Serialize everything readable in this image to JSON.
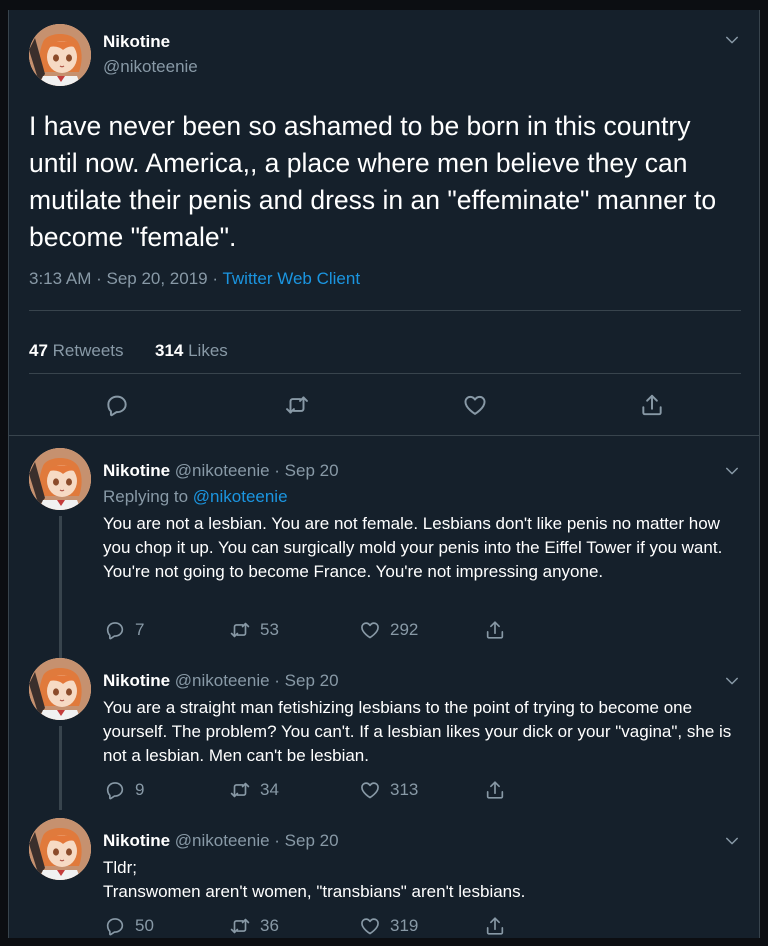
{
  "main_tweet": {
    "author_name": "Nikotine",
    "author_handle": "@nikoteenie",
    "text": "I have never been so ashamed to be born in this country until now. America,, a place where men believe they can mutilate their penis and dress in an \"effeminate\" manner to become \"female\".",
    "time": "3:13 AM · Sep 20, 2019 · ",
    "client": "Twitter Web Client",
    "retweets_count": "47",
    "retweets_label": " Retweets",
    "likes_count": "314",
    "likes_label": " Likes"
  },
  "replies": [
    {
      "author_name": "Nikotine",
      "author_handle": "@nikoteenie",
      "date": " · Sep 20",
      "replying_to_label": "Replying to ",
      "replying_to_handle": "@nikoteenie",
      "text": "You are not a lesbian. You are not female. Lesbians don't like penis no matter how you chop it up. You can surgically mold your penis into the Eiffel Tower if you want. You're not going to become France. You're not impressing anyone.",
      "replies": "7",
      "retweets": "53",
      "likes": "292"
    },
    {
      "author_name": "Nikotine",
      "author_handle": "@nikoteenie",
      "date": " · Sep 20",
      "text": "You are a straight man fetishizing lesbians to the point of trying to become one yourself. The problem? You can't. If a lesbian likes your dick or your \"vagina\", she is not a lesbian. Men can't be lesbian.",
      "replies": "9",
      "retweets": "34",
      "likes": "313"
    },
    {
      "author_name": "Nikotine",
      "author_handle": "@nikoteenie",
      "date": " · Sep 20",
      "text_line1": "Tldr;",
      "text_line2": "Transwomen aren't women, \"transbians\" aren't lesbians.",
      "replies": "50",
      "retweets": "36",
      "likes": "319"
    }
  ],
  "icons": {
    "reply": "reply-icon",
    "retweet": "retweet-icon",
    "like": "heart-icon",
    "share": "share-icon",
    "more": "chevron-down-icon"
  },
  "colors": {
    "background": "#15202b",
    "muted_text": "#8899a6",
    "link": "#1b95e0",
    "divider": "#38444d"
  }
}
